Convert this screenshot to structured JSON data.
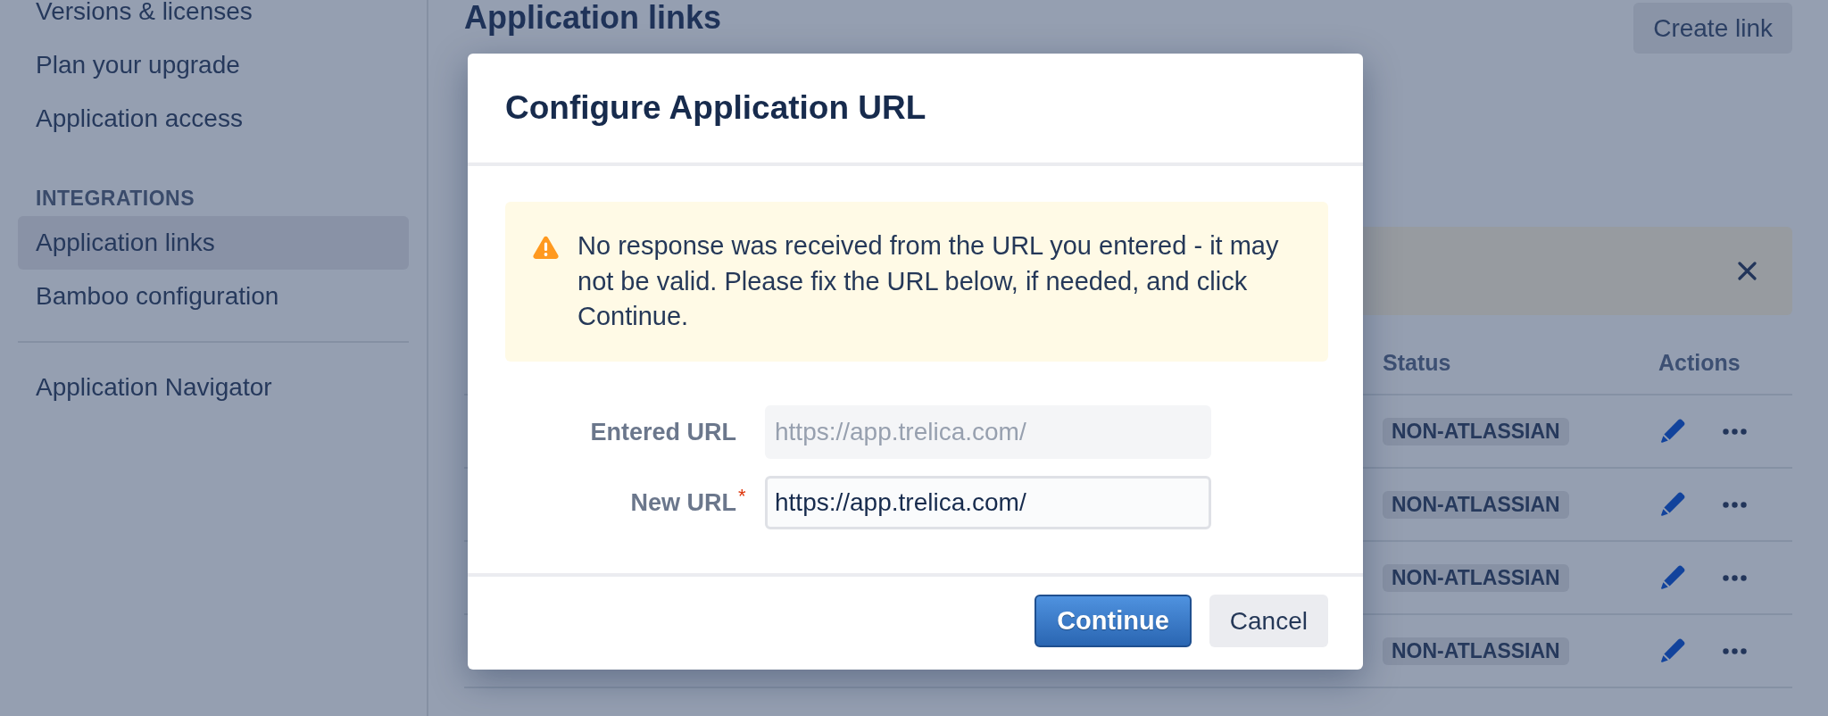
{
  "sidebar": {
    "sections": [
      {
        "kind": "links",
        "items": [
          {
            "label": "Versions & licenses",
            "selected": false
          },
          {
            "label": "Plan your upgrade",
            "selected": false
          },
          {
            "label": "Application access",
            "selected": false
          }
        ]
      },
      {
        "kind": "links",
        "heading": "INTEGRATIONS",
        "items": [
          {
            "label": "Application links",
            "selected": true
          },
          {
            "label": "Bamboo configuration",
            "selected": false
          }
        ]
      },
      {
        "kind": "divider"
      },
      {
        "kind": "links",
        "items": [
          {
            "label": "Application Navigator",
            "selected": false
          }
        ]
      }
    ]
  },
  "page": {
    "title": "Application links",
    "create_button": "Create link",
    "notice": {
      "dismissible": true
    }
  },
  "table": {
    "columns": [
      "Status",
      "Actions"
    ],
    "rows": [
      {
        "status": "NON-ATLASSIAN"
      },
      {
        "status": "NON-ATLASSIAN"
      },
      {
        "status": "NON-ATLASSIAN"
      },
      {
        "status": "NON-ATLASSIAN"
      }
    ]
  },
  "dialog": {
    "title": "Configure Application URL",
    "warning": "No response was received from the URL you entered - it may not be valid. Please fix the URL below, if needed, and click Continue.",
    "fields": [
      {
        "label": "Entered URL",
        "value": "https://app.trelica.com/",
        "disabled": true
      },
      {
        "label": "New URL",
        "required_mark": "*",
        "value": "https://app.trelica.com/",
        "disabled": false
      }
    ],
    "buttons": [
      {
        "label": "Continue",
        "kind": "primary"
      },
      {
        "label": "Cancel",
        "kind": "subtle"
      }
    ]
  }
}
